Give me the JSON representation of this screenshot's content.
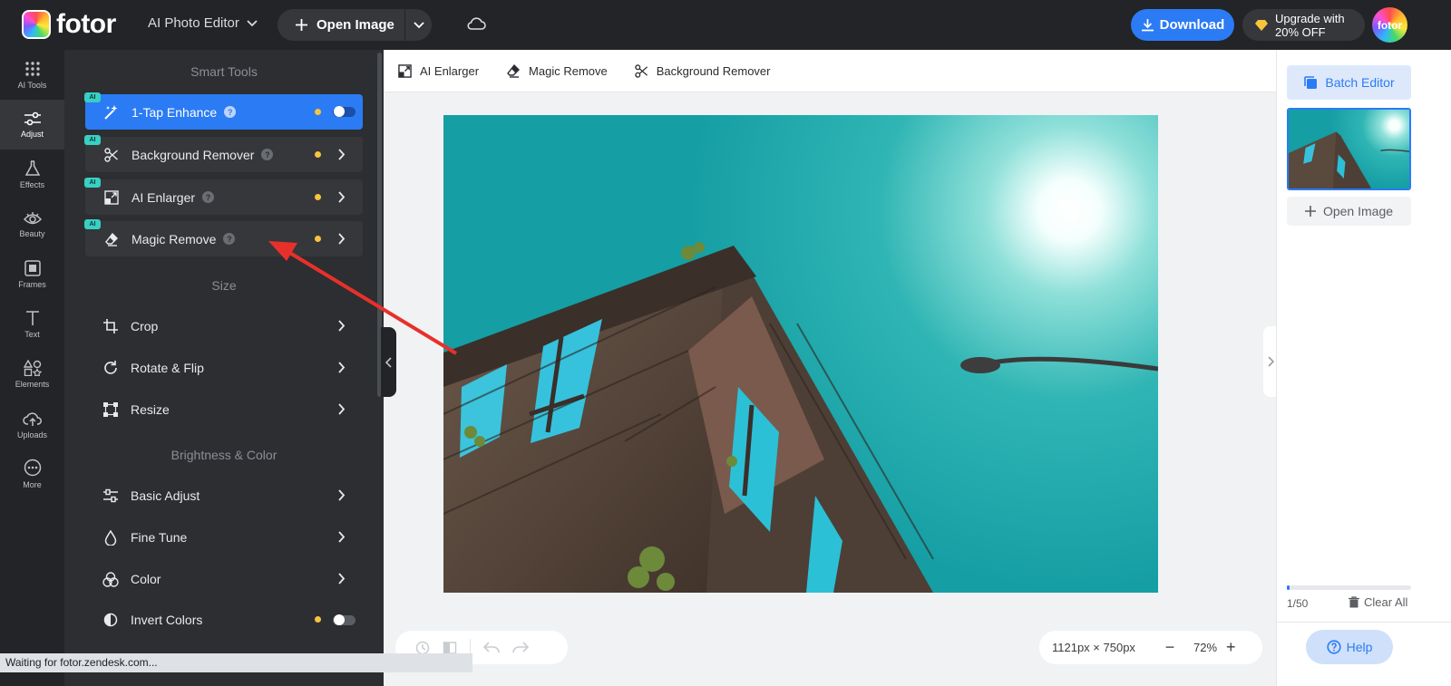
{
  "app": {
    "logo_text": "fotor",
    "editor_mode": "AI Photo Editor"
  },
  "topbar": {
    "open_image": "Open Image",
    "download": "Download",
    "upgrade_line1": "Upgrade with",
    "upgrade_line2": "20% OFF",
    "avatar_text": "fotor"
  },
  "rail": [
    {
      "label": "AI Tools",
      "icon": "grid-dots-icon"
    },
    {
      "label": "Adjust",
      "icon": "sliders-icon",
      "active": true
    },
    {
      "label": "Effects",
      "icon": "flask-icon"
    },
    {
      "label": "Beauty",
      "icon": "eye-icon"
    },
    {
      "label": "Frames",
      "icon": "frame-icon"
    },
    {
      "label": "Text",
      "icon": "text-icon"
    },
    {
      "label": "Elements",
      "icon": "shapes-icon"
    },
    {
      "label": "Uploads",
      "icon": "cloud-upload-icon"
    },
    {
      "label": "More",
      "icon": "more-icon"
    }
  ],
  "panel": {
    "smart_tools_title": "Smart Tools",
    "smart_tools": [
      {
        "label": "1-Tap Enhance",
        "badge": "AI",
        "active": true
      },
      {
        "label": "Background Remover",
        "badge": "AI"
      },
      {
        "label": "AI Enlarger",
        "badge": "AI"
      },
      {
        "label": "Magic Remove",
        "badge": "AI"
      }
    ],
    "size_title": "Size",
    "size_tools": [
      {
        "label": "Crop"
      },
      {
        "label": "Rotate & Flip"
      },
      {
        "label": "Resize"
      }
    ],
    "brightness_title": "Brightness & Color",
    "brightness_tools": [
      {
        "label": "Basic Adjust"
      },
      {
        "label": "Fine Tune"
      },
      {
        "label": "Color"
      },
      {
        "label": "Invert Colors"
      }
    ]
  },
  "main_toolbar": [
    {
      "label": "AI Enlarger"
    },
    {
      "label": "Magic Remove"
    },
    {
      "label": "Background Remover"
    }
  ],
  "canvas": {
    "dimensions": "1121px × 750px",
    "zoom": "72%"
  },
  "right_panel": {
    "batch_editor": "Batch Editor",
    "open_image": "Open Image",
    "count": "1/50",
    "progress": 0.02,
    "clear_all": "Clear All",
    "help": "Help"
  },
  "status_bar": "Waiting for fotor.zendesk.com...",
  "colors": {
    "accent": "#2b7bf4",
    "dark": "#222427",
    "panel": "#2c2e32",
    "sky": "#1fa8ad",
    "arrow": "#e8302a"
  }
}
